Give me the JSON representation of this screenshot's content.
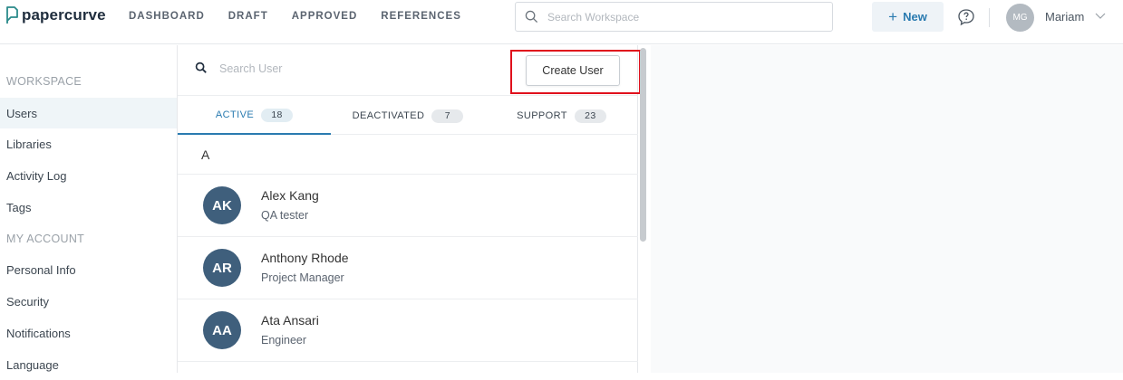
{
  "app": {
    "name": "papercurve"
  },
  "nav": {
    "items": [
      "DASHBOARD",
      "DRAFT",
      "APPROVED",
      "REFERENCES"
    ]
  },
  "search_workspace": {
    "placeholder": "Search Workspace"
  },
  "new_button": {
    "label": "New"
  },
  "user": {
    "initials": "MG",
    "name": "Mariam"
  },
  "sidebar": {
    "workspace_section": "WORKSPACE",
    "workspace_items": [
      "Users",
      "Libraries",
      "Activity Log",
      "Tags"
    ],
    "account_section": "MY ACCOUNT",
    "account_items": [
      "Personal Info",
      "Security",
      "Notifications",
      "Language"
    ]
  },
  "users_panel": {
    "search_placeholder": "Search User",
    "create_label": "Create User",
    "tabs": [
      {
        "label": "ACTIVE",
        "count": "18"
      },
      {
        "label": "DEACTIVATED",
        "count": "7"
      },
      {
        "label": "SUPPORT",
        "count": "23"
      }
    ],
    "group_letter": "A",
    "users": [
      {
        "initials": "AK",
        "name": "Alex Kang",
        "role": "QA tester"
      },
      {
        "initials": "AR",
        "name": "Anthony Rhode",
        "role": "Project Manager"
      },
      {
        "initials": "AA",
        "name": "Ata Ansari",
        "role": "Engineer"
      }
    ]
  },
  "colors": {
    "accent": "#2a7bb0",
    "avatar": "#3f5f7c",
    "highlight_box": "#e0101c"
  }
}
